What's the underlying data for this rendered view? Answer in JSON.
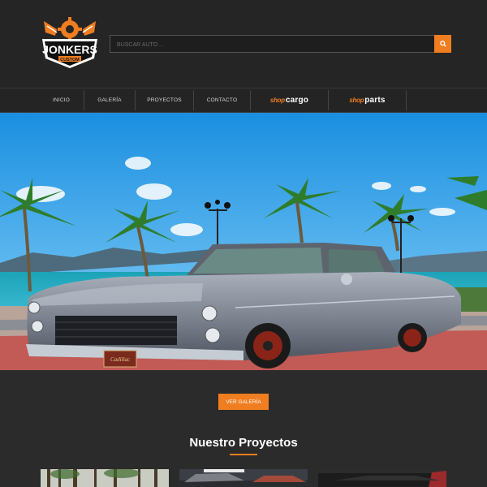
{
  "logo": {
    "brand": "JONKERS",
    "sub": "CUSTOM"
  },
  "search": {
    "placeholder": "BUSCAR AUTO ..."
  },
  "nav": {
    "items": [
      {
        "label": "INICIO"
      },
      {
        "label": "GALERÍA"
      },
      {
        "label": "PROYECTOS"
      },
      {
        "label": "CONTACTO"
      }
    ],
    "brands": [
      {
        "prefix": "shop",
        "word": "cargo"
      },
      {
        "prefix": "shop",
        "word": "parts"
      }
    ]
  },
  "hero": {
    "plate_text": "Cadillac"
  },
  "cta": {
    "label": "VER GALERÍA"
  },
  "projects": {
    "title": "Nuestro Proyectos"
  },
  "colors": {
    "accent": "#f07d1f",
    "background": "#2b2b2b",
    "header": "#252525"
  },
  "icons": {
    "search": "search-icon"
  }
}
